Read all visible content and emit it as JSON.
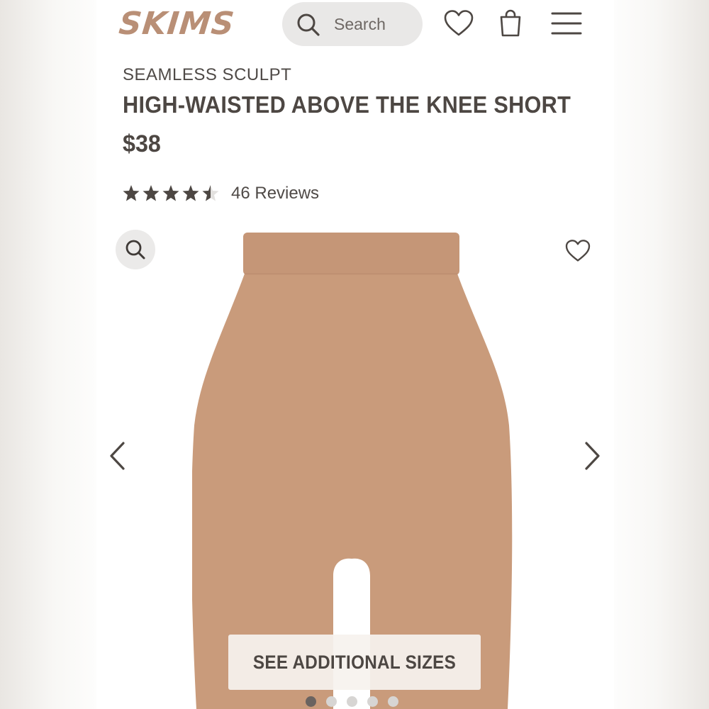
{
  "header": {
    "logo_text": "SKIMS",
    "search_placeholder": "Search",
    "icons": [
      "search-icon",
      "heart-icon",
      "shopping-bag-icon",
      "hamburger-menu-icon"
    ]
  },
  "product": {
    "collection": "SEAMLESS SCULPT",
    "title": "HIGH-WAISTED ABOVE THE KNEE SHORT",
    "price": "$38",
    "rating": 4.5,
    "rating_max": 5,
    "reviews": "46 Reviews",
    "product_color": "#c99b7b"
  },
  "gallery": {
    "icons": [
      "zoom-icon",
      "wishlist-heart-icon",
      "chevron-left-icon",
      "chevron-right-icon"
    ],
    "cta": "SEE ADDITIONAL SIZES",
    "slide_count": 5,
    "active_slide": 1
  },
  "colors": {
    "logo": "#b98f76",
    "text": "#4d4743"
  }
}
